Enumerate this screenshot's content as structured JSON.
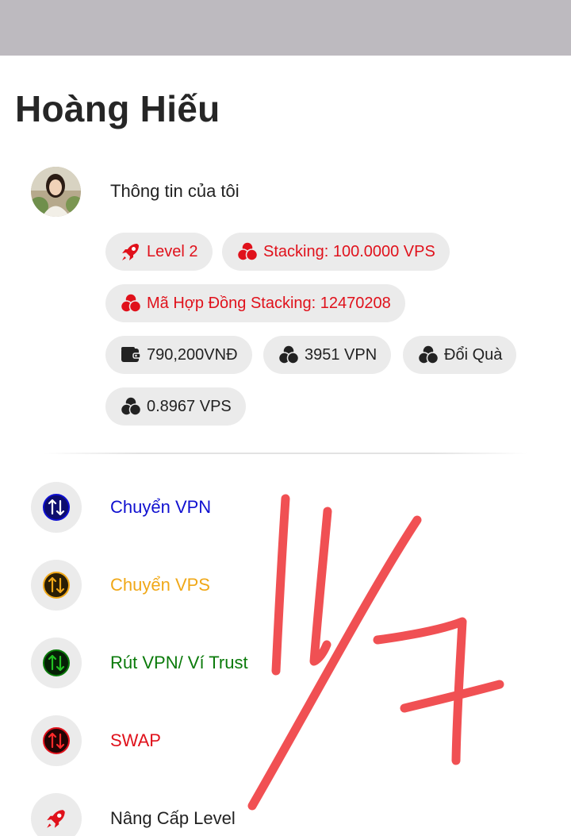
{
  "profile": {
    "name": "Hoàng Hiếu",
    "my_info_label": "Thông tin của tôi"
  },
  "chips": {
    "level": "Level 2",
    "stacking": "Stacking: 100.0000 VPS",
    "contract": "Mã Hợp Đồng Stacking: 12470208",
    "wallet": "790,200VNĐ",
    "vpn_balance": "3951 VPN",
    "exchange": "Đổi Quà",
    "vps_balance": "0.8967 VPS"
  },
  "menu": [
    {
      "label": "Chuyển VPN",
      "color": "#1010d0",
      "icon": "transfer-icon"
    },
    {
      "label": "Chuyển VPS",
      "color": "#f0a818",
      "icon": "transfer-icon"
    },
    {
      "label": "Rút VPN/ Ví Trust",
      "color": "#0a7a0a",
      "icon": "transfer-icon"
    },
    {
      "label": "SWAP",
      "color": "#e0111b",
      "icon": "transfer-icon"
    },
    {
      "label": "Nâng Cấp Level",
      "color": "#222222",
      "icon": "rocket-icon"
    }
  ],
  "handwriting": {
    "text": "11/7",
    "color": "#f0474a"
  }
}
